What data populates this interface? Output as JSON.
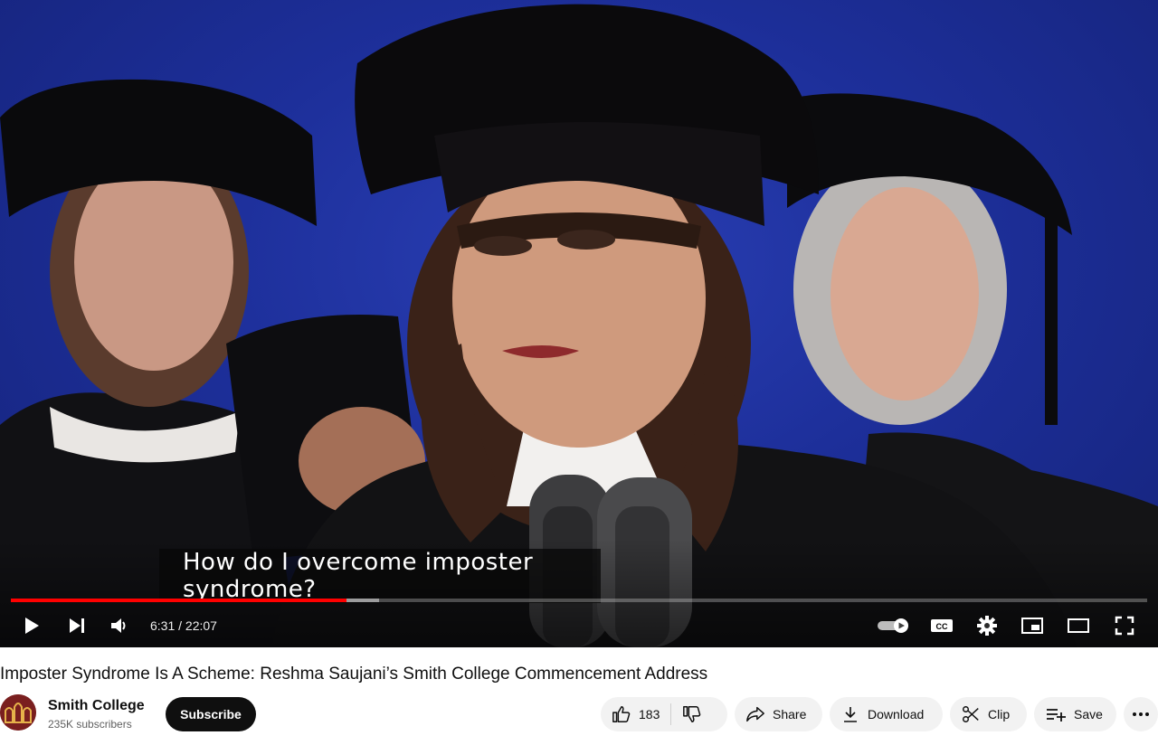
{
  "player": {
    "caption_lines": [
      "How do I overcome imposter",
      "syndrome?"
    ],
    "time_display": "6:31 / 22:07",
    "progress_fraction": 0.295,
    "buffered_fraction": 0.324,
    "controls": [
      "play-icon",
      "next-icon",
      "volume-icon",
      "autoplay-toggle",
      "subtitles-icon",
      "settings-icon",
      "miniplayer-icon",
      "theater-icon",
      "fullscreen-icon"
    ]
  },
  "video": {
    "title": "Imposter Syndrome Is A Scheme: Reshma Saujani’s Smith College Commencement Address"
  },
  "channel": {
    "name": "Smith College",
    "subscribers": "235K subscribers",
    "subscribe_label": "Subscribe"
  },
  "actions": {
    "like_count": "183",
    "share_label": "Share",
    "download_label": "Download",
    "clip_label": "Clip",
    "save_label": "Save"
  },
  "colors": {
    "accent": "#ff0000",
    "background_blue": "#1d2f9a",
    "button_dark": "#0f0f0f",
    "pill_bg": "#f2f2f2"
  }
}
